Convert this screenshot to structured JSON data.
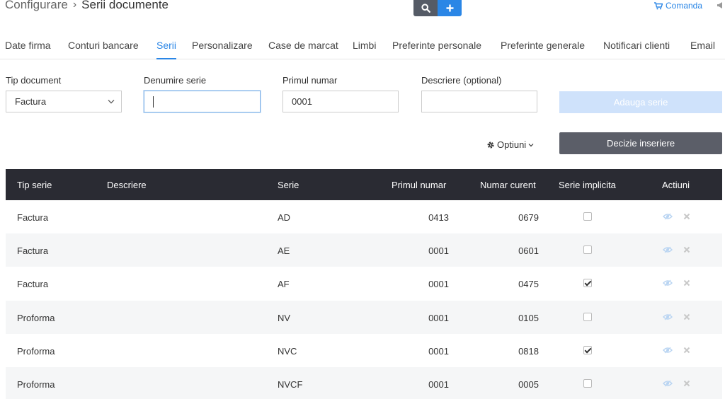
{
  "header": {
    "breadcrumb_root": "Configurare",
    "breadcrumb_sep": "›",
    "title": "Serii documente",
    "comanda_label": "Comanda"
  },
  "tabs": [
    {
      "label": "Date firma"
    },
    {
      "label": "Conturi bancare"
    },
    {
      "label": "Serii"
    },
    {
      "label": "Personalizare"
    },
    {
      "label": "Case de marcat"
    },
    {
      "label": "Limbi"
    },
    {
      "label": "Preferinte personale"
    },
    {
      "label": "Preferinte generale"
    },
    {
      "label": "Notificari clienti"
    },
    {
      "label": "Email"
    }
  ],
  "active_tab": "Serii",
  "form": {
    "tip_document_label": "Tip document",
    "tip_document_value": "Factura",
    "denumire_label": "Denumire serie",
    "denumire_value": "",
    "primul_label": "Primul numar",
    "primul_value": "0001",
    "descriere_label": "Descriere",
    "descriere_optional": "(optional)",
    "descriere_value": "",
    "add_button": "Adauga serie",
    "optiuni_label": "Optiuni",
    "decizie_button": "Decizie inseriere"
  },
  "table": {
    "headers": [
      "Tip serie",
      "Descriere",
      "Serie",
      "Primul numar",
      "Numar curent",
      "Serie implicita",
      "Actiuni"
    ],
    "rows": [
      {
        "tip": "Factura",
        "descriere": "",
        "serie": "AD",
        "primul": "0413",
        "curent": "0679",
        "implicita": false
      },
      {
        "tip": "Factura",
        "descriere": "",
        "serie": "AE",
        "primul": "0001",
        "curent": "0601",
        "implicita": false
      },
      {
        "tip": "Factura",
        "descriere": "",
        "serie": "AF",
        "primul": "0001",
        "curent": "0475",
        "implicita": true
      },
      {
        "tip": "Proforma",
        "descriere": "",
        "serie": "NV",
        "primul": "0001",
        "curent": "0105",
        "implicita": false
      },
      {
        "tip": "Proforma",
        "descriere": "",
        "serie": "NVC",
        "primul": "0001",
        "curent": "0818",
        "implicita": true
      },
      {
        "tip": "Proforma",
        "descriere": "",
        "serie": "NVCF",
        "primul": "0001",
        "curent": "0005",
        "implicita": false
      }
    ]
  },
  "icons": {
    "search": "search-icon",
    "add": "plus-icon",
    "cart": "cart-icon",
    "gear": "gear-icon",
    "chevron": "chevron-down-icon",
    "view": "eye-icon",
    "delete": "close-icon"
  },
  "colors": {
    "accent": "#2a86e6",
    "header_bg": "#2a2b33",
    "button_dark": "#5b5e68",
    "button_disabled": "#cfe2fb"
  }
}
